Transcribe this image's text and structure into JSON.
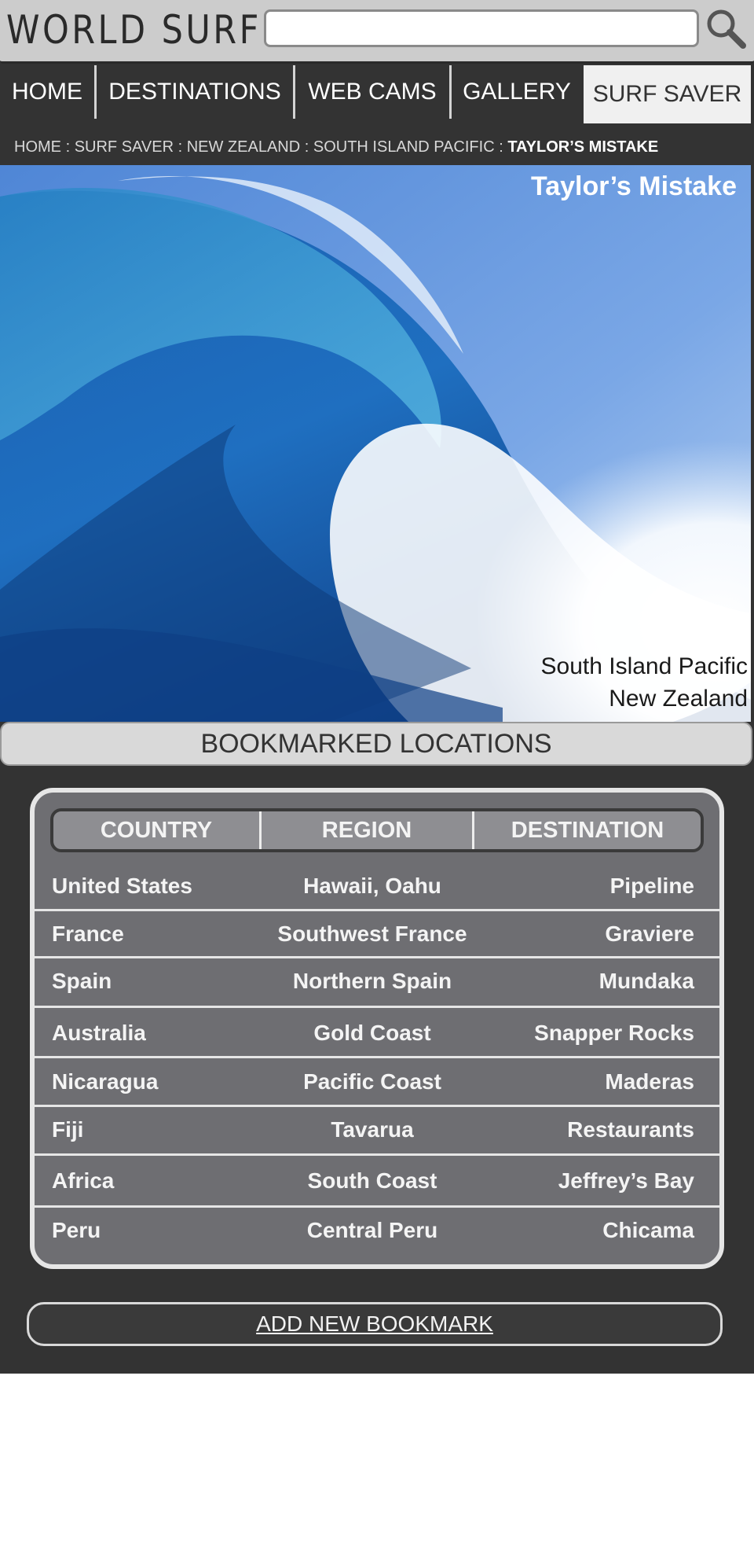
{
  "app": {
    "logo": "WORLD SURF"
  },
  "search": {
    "value": "",
    "placeholder": "",
    "icon": "search-icon"
  },
  "nav": {
    "items": [
      {
        "label": "HOME"
      },
      {
        "label": "DESTINATIONS"
      },
      {
        "label": "WEB CAMS"
      },
      {
        "label": "GALLERY"
      },
      {
        "label": "SURF SAVER",
        "active": true
      }
    ]
  },
  "breadcrumb": {
    "items": [
      "HOME",
      "SURF SAVER",
      "NEW ZEALAND",
      "SOUTH ISLAND PACIFIC"
    ],
    "separator": ":",
    "current": "TAYLOR’S MISTAKE"
  },
  "hero": {
    "title": "Taylor’s Mistake",
    "region": "South Island Pacific",
    "country": "New Zealand"
  },
  "bookmarks": {
    "heading": "BOOKMARKED LOCATIONS",
    "columns": [
      "COUNTRY",
      "REGION",
      "DESTINATION"
    ],
    "rows": [
      {
        "country": "United States",
        "region": "Hawaii, Oahu",
        "destination": "Pipeline"
      },
      {
        "country": "France",
        "region": "Southwest France",
        "destination": "Graviere"
      },
      {
        "country": "Spain",
        "region": "Northern Spain",
        "destination": "Mundaka"
      },
      {
        "country": "Australia",
        "region": "Gold Coast",
        "destination": "Snapper Rocks"
      },
      {
        "country": "Nicaragua",
        "region": "Pacific Coast",
        "destination": "Maderas"
      },
      {
        "country": "Fiji",
        "region": "Tavarua",
        "destination": "Restaurants"
      },
      {
        "country": "Africa",
        "region": "South Coast",
        "destination": "Jeffrey’s Bay"
      },
      {
        "country": "Peru",
        "region": "Central Peru",
        "destination": "Chicama"
      }
    ],
    "add_label": "ADD NEW BOOKMARK"
  },
  "colors": {
    "page_background": "#333333",
    "header_background": "#cccccc",
    "nav_active_background": "#f0f0f0",
    "table_background": "#6e6e72",
    "table_border": "#e6e6e6",
    "text_light": "#ffffff"
  }
}
